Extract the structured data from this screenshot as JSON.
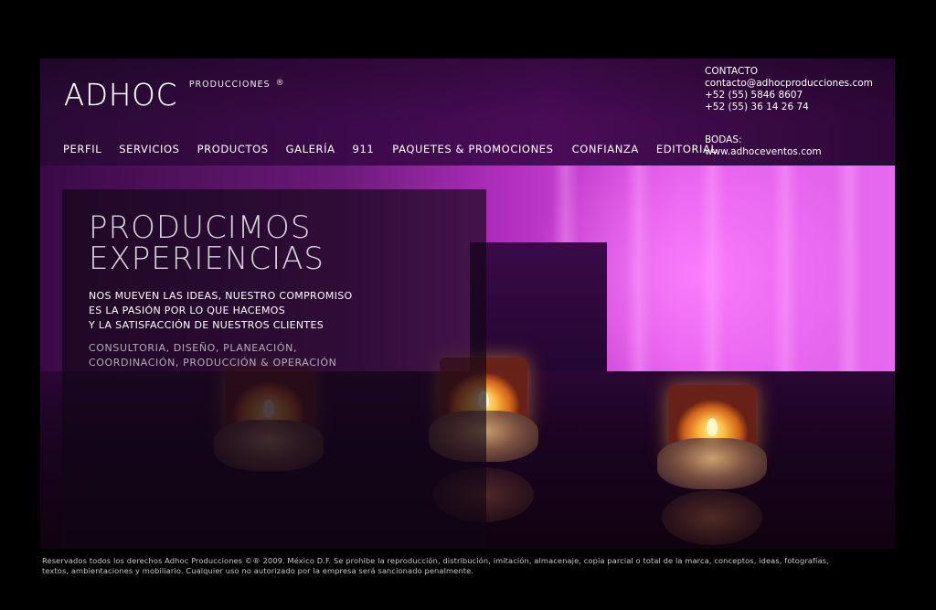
{
  "brand": {
    "logo_text": "ADHOC",
    "subtitle": "PRODUCCIONES",
    "registered": "®"
  },
  "nav": {
    "items": [
      {
        "label": "PERFIL"
      },
      {
        "label": "SERVICIOS"
      },
      {
        "label": "PRODUCTOS"
      },
      {
        "label": "GALERÍA"
      },
      {
        "label": "911"
      },
      {
        "label": "PAQUETES & PROMOCIONES"
      },
      {
        "label": "CONFIANZA"
      },
      {
        "label": "EDITORIAL"
      }
    ]
  },
  "contact": {
    "heading": "CONTACTO",
    "email": "contacto@adhocproducciones.com",
    "phone1": "+52 (55) 5846 8607",
    "phone2": "+52 (55) 36 14 26 74",
    "weddings_heading": "BODAS:",
    "weddings_site": "www.adhoceventos.com"
  },
  "hero": {
    "headline_line1": "PRODUCIMOS",
    "headline_line2": "EXPERIENCIAS",
    "tagline_line1": "NOS MUEVEN LAS IDEAS, NUESTRO COMPROMISO",
    "tagline_line2": "ES LA PASIÓN POR LO QUE HACEMOS",
    "tagline_line3": "Y LA SATISFACCIÓN DE NUESTROS CLIENTES",
    "services_line1": "CONSULTORIA, DISEÑO, PLANEACIÓN,",
    "services_line2": "COORDINACIÓN, PRODUCCIÓN & OPERACIÓN"
  },
  "footer": {
    "line1": "Reservados todos los derechos Adhoc Producciones ©® 2009. México D.F. Se prohibe la reproducción, distribución, imitación, almacenaje, copia parcial o total de la marca, conceptos, ideas, fotografías,",
    "line2": "textos, ambientaciones y mobiliario. Cualquier uso no autorizado por la empresa será sancionado penalmente."
  },
  "colors": {
    "background": "#000000",
    "header_band": "#3c0a4a",
    "accent_magenta": "#e15ae8",
    "headline_gray": "#d8d2dc",
    "services_gray": "#b3abb8"
  }
}
